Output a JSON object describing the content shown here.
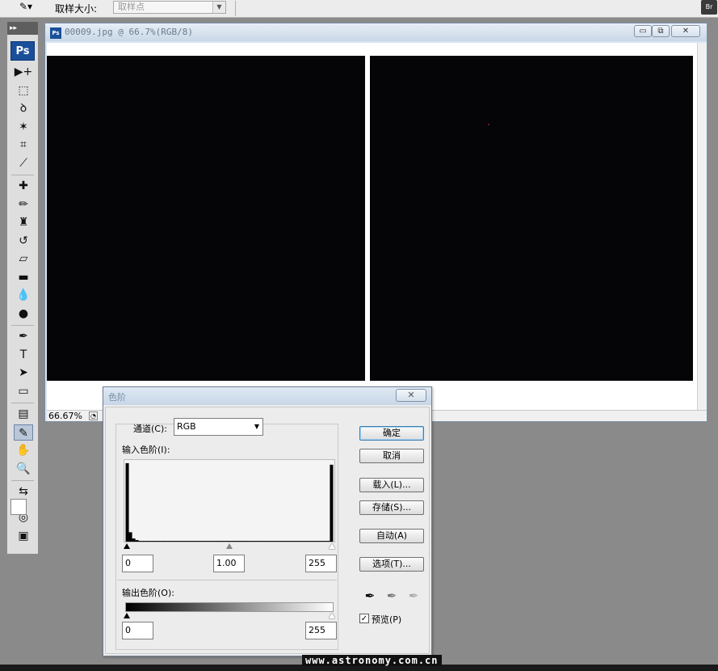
{
  "options_bar": {
    "sample_size_label": "取样大小:",
    "sample_size_value": "取样点",
    "dropdown_arrow": "▼",
    "tool_icon": "eyedropper-icon",
    "tool_glyph": "✎▾",
    "bridge_label": "Br"
  },
  "watermark": "www.astronomy.com.cn",
  "toolbox": {
    "grip_label": "▸▸",
    "logo": "Ps",
    "tools": [
      {
        "name": "move-tool",
        "glyph": "▶+"
      },
      {
        "name": "marquee-tool",
        "glyph": "⬚"
      },
      {
        "name": "lasso-tool",
        "glyph": "ꝺ"
      },
      {
        "name": "magic-wand-tool",
        "glyph": "✶"
      },
      {
        "name": "crop-tool",
        "glyph": "⌗"
      },
      {
        "name": "slice-tool",
        "glyph": "⟋"
      },
      {
        "name": "healing-brush-tool",
        "glyph": "✚"
      },
      {
        "name": "brush-tool",
        "glyph": "✏"
      },
      {
        "name": "clone-stamp-tool",
        "glyph": "♜"
      },
      {
        "name": "history-brush-tool",
        "glyph": "↺"
      },
      {
        "name": "eraser-tool",
        "glyph": "▱"
      },
      {
        "name": "gradient-tool",
        "glyph": "▬"
      },
      {
        "name": "blur-tool",
        "glyph": "💧"
      },
      {
        "name": "dodge-tool",
        "glyph": "●"
      },
      {
        "name": "pen-tool",
        "glyph": "✒"
      },
      {
        "name": "type-tool",
        "glyph": "T"
      },
      {
        "name": "path-selection-tool",
        "glyph": "➤"
      },
      {
        "name": "shape-tool",
        "glyph": "▭"
      },
      {
        "name": "notes-tool",
        "glyph": "▤"
      },
      {
        "name": "eyedropper-tool",
        "glyph": "✎"
      },
      {
        "name": "hand-tool",
        "glyph": "✋"
      },
      {
        "name": "zoom-tool",
        "glyph": "🔍"
      },
      {
        "name": "swap-colors",
        "glyph": "⇆"
      },
      {
        "name": "quick-mask-tool",
        "glyph": "◎"
      },
      {
        "name": "screen-mode-tool",
        "glyph": "▣"
      }
    ]
  },
  "document": {
    "title": "00009.jpg @ 66.7%(RGB/8)",
    "zoom": "66.67%",
    "buttons": {
      "minimize": "▭",
      "restore": "⧉",
      "close": "✕"
    },
    "icon_label": "Ps"
  },
  "levels_dialog": {
    "title": "色阶",
    "close_label": "✕",
    "channel_label": "通道(C):",
    "channel_value": "RGB",
    "channel_arrow": "▼",
    "input_levels_label": "输入色阶(I):",
    "input_values": [
      "0",
      "1.00",
      "255"
    ],
    "output_levels_label": "输出色阶(O):",
    "output_values": [
      "0",
      "255"
    ],
    "buttons": {
      "ok": "确定",
      "cancel": "取消",
      "load": "载入(L)...",
      "save": "存储(S)...",
      "auto": "自动(A)",
      "options": "选项(T)..."
    },
    "preview_label": "预览(P)",
    "preview_checked": "✓",
    "eyedropper_glyph": "✒",
    "histogram": {
      "bins": [
        100,
        12,
        4,
        2,
        1,
        1,
        1,
        1,
        1,
        1,
        1,
        1,
        1,
        1,
        1,
        1,
        1,
        1,
        1,
        1,
        1,
        1,
        1,
        1,
        1,
        1,
        1,
        1,
        1,
        1,
        1,
        1,
        1,
        1,
        1,
        1,
        1,
        1,
        1,
        1,
        1,
        1,
        1,
        1,
        1,
        1,
        1,
        1,
        1,
        1,
        1,
        1,
        1,
        1,
        1,
        1,
        1,
        1,
        1,
        1,
        1,
        1,
        1,
        98
      ]
    }
  },
  "colors": {
    "ps_blue": "#1a4f9a",
    "image_black": "#050507",
    "workspace_gray": "#8a8a8a"
  }
}
